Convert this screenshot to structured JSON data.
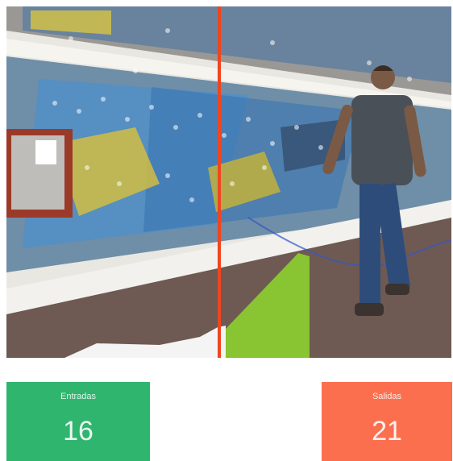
{
  "video": {
    "description_icon": "camera-feed",
    "line_color": "#f0451f",
    "trail_color": "#3355cc"
  },
  "counters": {
    "entradas": {
      "label": "Entradas",
      "value": "16",
      "color": "#2fb56e"
    },
    "salidas": {
      "label": "Salidas",
      "value": "21",
      "color": "#fb6f4e"
    }
  }
}
